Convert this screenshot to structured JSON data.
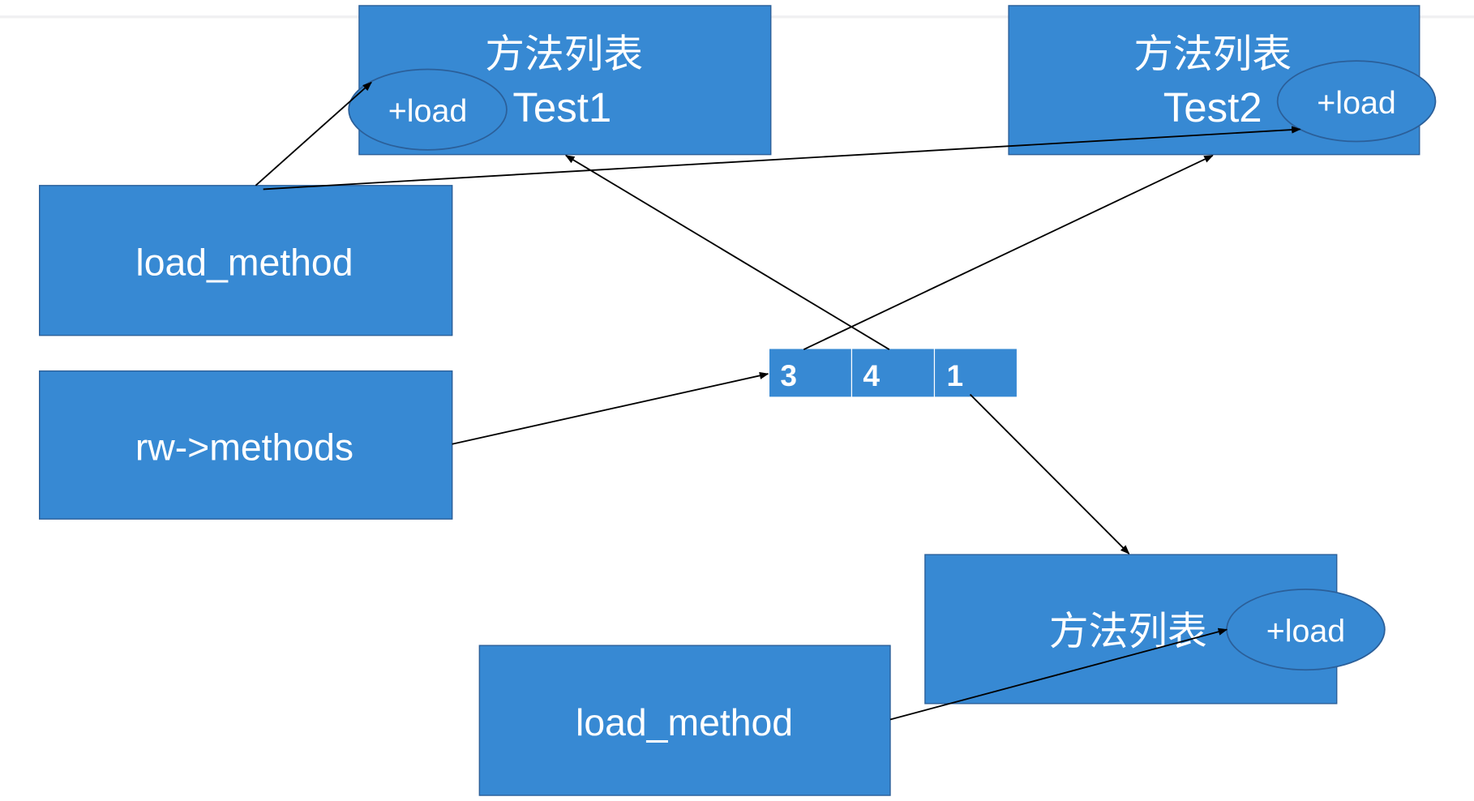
{
  "boxes": {
    "test1": {
      "title": "方法列表",
      "name": "Test1",
      "method": "+load"
    },
    "test2": {
      "title": "方法列表",
      "name": "Test2",
      "method": "+load"
    },
    "third": {
      "title": "方法列表",
      "method": "+load"
    },
    "load_method_top": "load_method",
    "rw_methods": "rw->methods",
    "load_method_bottom": "load_method"
  },
  "array_cells": [
    "3",
    "4",
    "1"
  ],
  "colors": {
    "box_fill": "#3789d3",
    "box_border": "#2b5f99",
    "arrow": "#000000"
  }
}
